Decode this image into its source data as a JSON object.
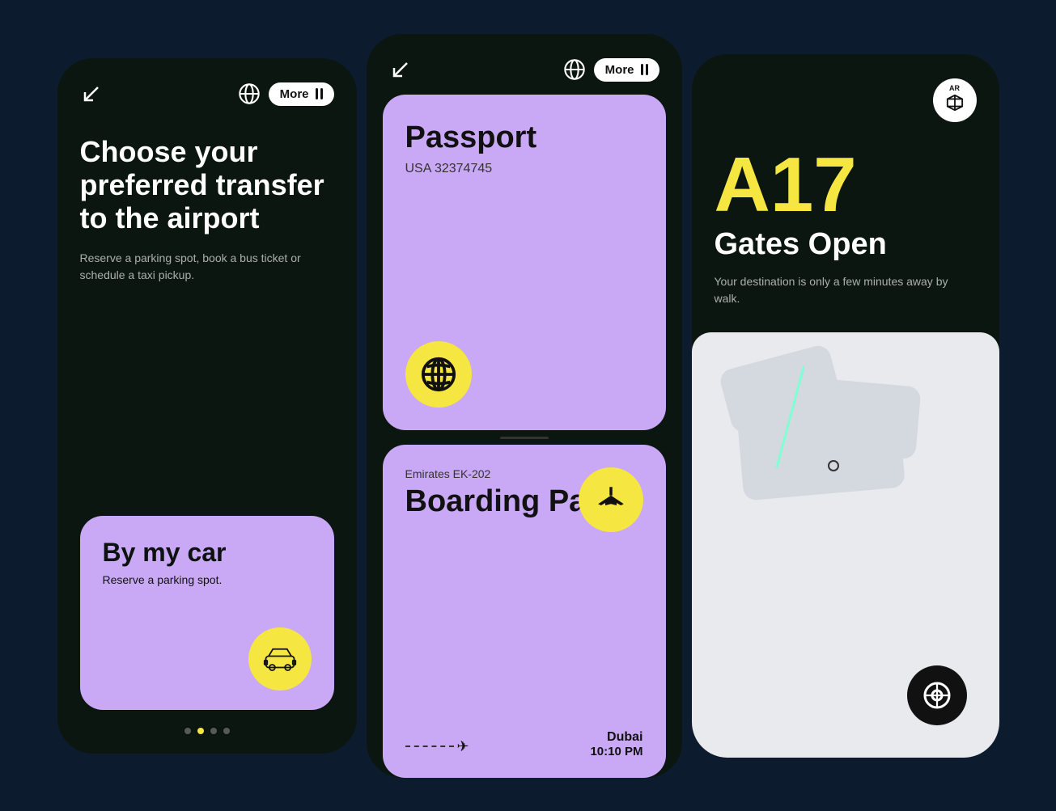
{
  "phone1": {
    "heading": "Choose your preferred transfer to the airport",
    "subtext": "Reserve a parking spot, book a bus ticket or schedule a taxi pickup.",
    "more_label": "More",
    "card": {
      "title": "By my car",
      "subtitle": "Reserve a parking spot."
    },
    "dots": [
      {
        "active": false
      },
      {
        "active": true
      },
      {
        "active": false
      },
      {
        "active": false
      }
    ]
  },
  "phone2": {
    "more_label": "More",
    "passport": {
      "title": "Passport",
      "number": "USA 32374745"
    },
    "boarding": {
      "flight": "Emirates EK-202",
      "title": "Boarding Pass",
      "destination": "Dubai",
      "time": "10:10 PM"
    }
  },
  "phone3": {
    "ar_label": "AR",
    "gate": "A17",
    "gates_open": "Gates Open",
    "description": "Your destination is only a few minutes away by walk."
  }
}
